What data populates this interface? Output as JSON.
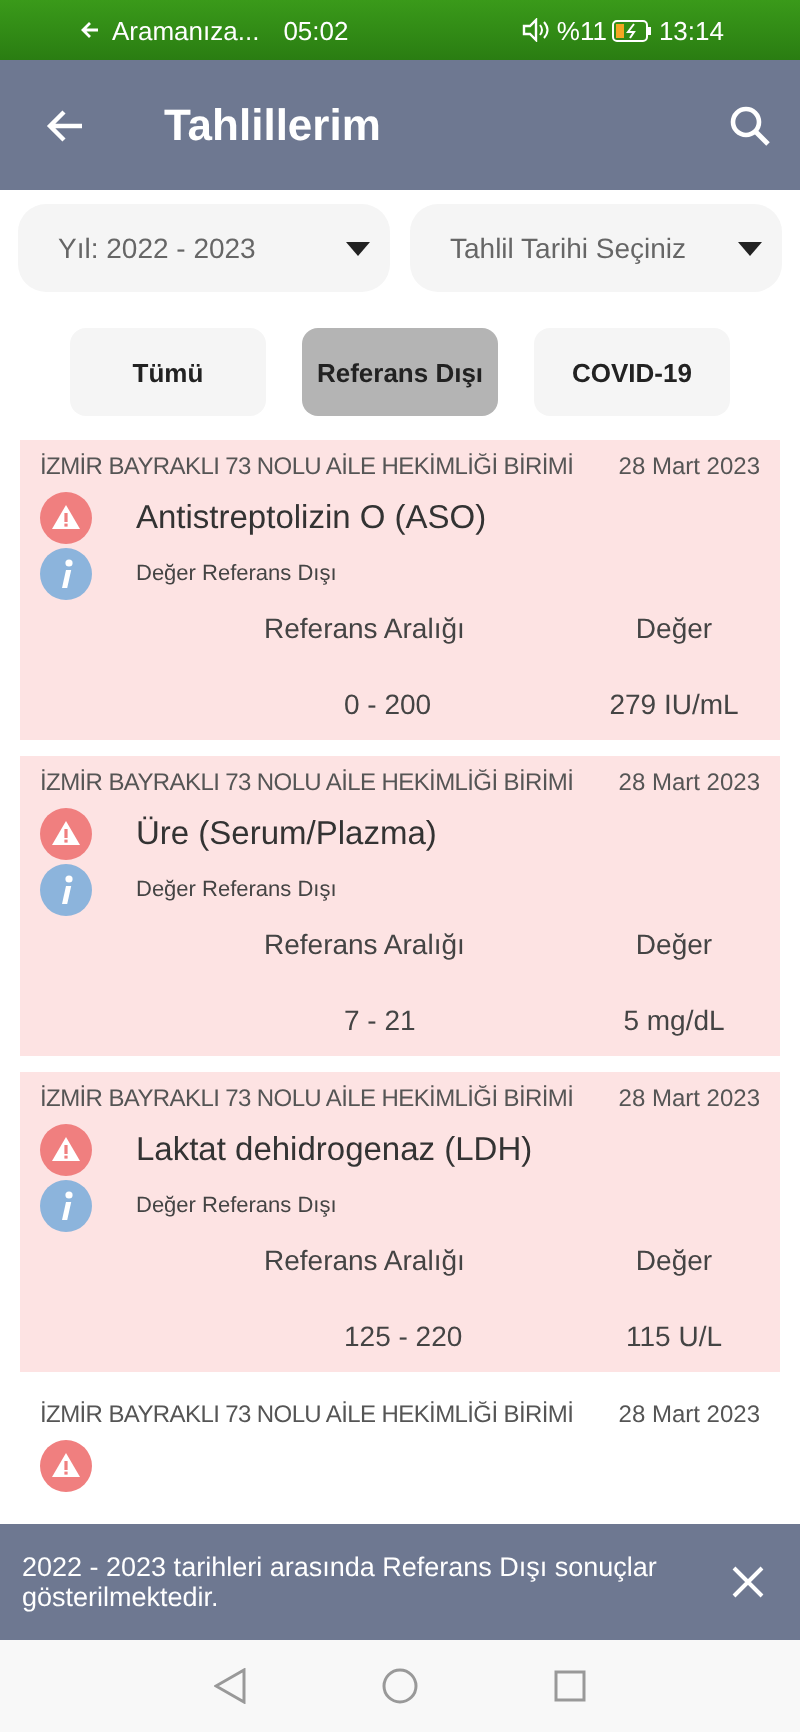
{
  "status_bar": {
    "call": "Aramanıza...",
    "call_time": "05:02",
    "battery": "%11",
    "time": "13:14"
  },
  "app_bar": {
    "title": "Tahlillerim"
  },
  "filters": [
    {
      "label": "Yıl: 2022 - 2023"
    },
    {
      "label": "Tahlil Tarihi Seçiniz"
    }
  ],
  "tabs": [
    {
      "label": "Tümü",
      "selected": false
    },
    {
      "label": "Referans Dışı",
      "selected": true
    },
    {
      "label": "COVID-19",
      "selected": false
    }
  ],
  "results": [
    {
      "institution": "İZMİR BAYRAKLI 73 NOLU AİLE HEKİMLİĞİ BİRİMİ",
      "date": "28 Mart 2023",
      "highlighted": true,
      "test": "Antistreptolizin O (ASO)",
      "note": "Değer Referans Dışı",
      "range_label": "Referans Aralığı",
      "value_label": "Değer",
      "range": "0 - 200",
      "value": "279 IU/mL"
    },
    {
      "institution": "İZMİR BAYRAKLI 73 NOLU AİLE HEKİMLİĞİ BİRİMİ",
      "date": "28 Mart 2023",
      "highlighted": true,
      "test": "Üre (Serum/Plazma)",
      "note": "Değer Referans Dışı",
      "range_label": "Referans Aralığı",
      "value_label": "Değer",
      "range": "7 - 21",
      "value": "5 mg/dL"
    },
    {
      "institution": "İZMİR BAYRAKLI 73 NOLU AİLE HEKİMLİĞİ BİRİMİ",
      "date": "28 Mart 2023",
      "highlighted": true,
      "test": "Laktat dehidrogenaz (LDH)",
      "note": "Değer Referans Dışı",
      "range_label": "Referans Aralığı",
      "value_label": "Değer",
      "range": "125 - 220",
      "value": "115 U/L"
    },
    {
      "institution": "İZMİR BAYRAKLI 73 NOLU AİLE HEKİMLİĞİ BİRİMİ",
      "date": "28 Mart 2023",
      "highlighted": false
    }
  ],
  "snackbar": {
    "message": "2022 - 2023 tarihleri arasında Referans Dışı sonuçlar gösterilmektedir."
  }
}
